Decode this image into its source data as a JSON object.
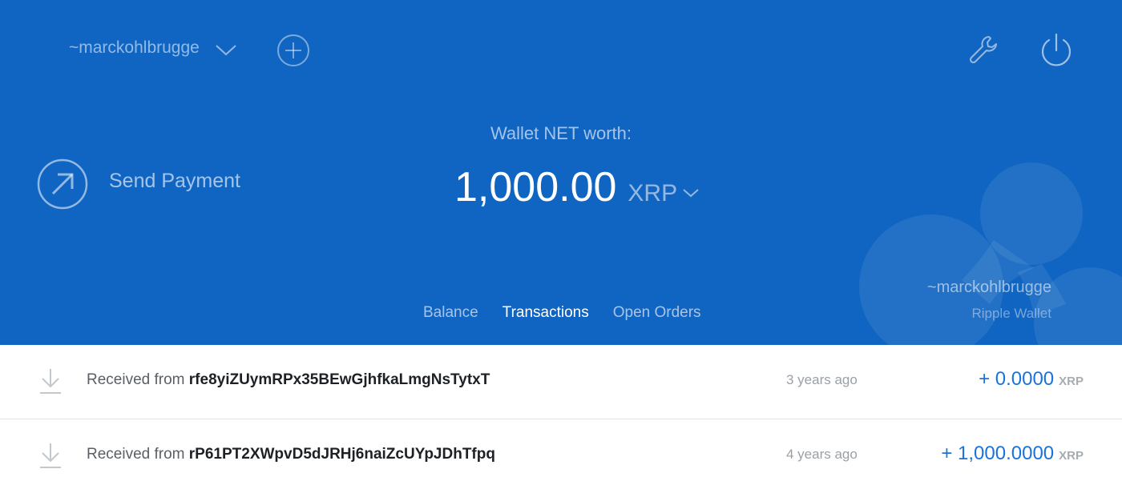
{
  "header": {
    "account_name": "~marckohlbrugge",
    "icons": {
      "account_dropdown": "chevron-down-icon",
      "add_account": "plus-circle-icon",
      "settings": "wrench-icon",
      "power": "power-icon",
      "send": "arrow-up-right-circle-icon",
      "logo": "ripple-logo"
    }
  },
  "send_payment": {
    "label": "Send Payment"
  },
  "net_worth": {
    "label": "Wallet NET worth:",
    "amount": "1,000.00",
    "currency": "XRP"
  },
  "wallet_card": {
    "name": "~marckohlbrugge",
    "subtitle": "Ripple Wallet"
  },
  "tabs": [
    {
      "label": "Balance",
      "active": false
    },
    {
      "label": "Transactions",
      "active": true
    },
    {
      "label": "Open Orders",
      "active": false
    }
  ],
  "transactions": [
    {
      "prefix": "Received from",
      "address": "rfe8yiZUymRPx35BEwGjhfkaLmgNsTytxT",
      "time": "3 years ago",
      "amount": "+ 0.0000",
      "unit": "XRP",
      "icon": "download-icon"
    },
    {
      "prefix": "Received from",
      "address": "rP61PT2XWpvD5dJRHj6naiZcUYpJDhTfpq",
      "time": "4 years ago",
      "amount": "+ 1,000.0000",
      "unit": "XRP",
      "icon": "download-icon"
    }
  ],
  "colors": {
    "header_bg": "#1065c2",
    "amount_blue": "#1a73d9",
    "divider": "#dfe3e8"
  }
}
